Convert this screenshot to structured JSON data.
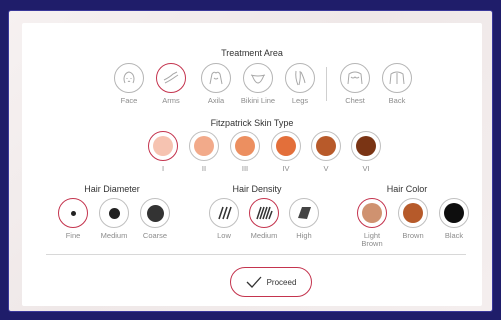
{
  "treatment_area": {
    "title": "Treatment Area",
    "items": [
      {
        "label": "Face",
        "icon": "face-icon",
        "selected": false
      },
      {
        "label": "Arms",
        "icon": "arm-icon",
        "selected": true
      },
      {
        "label": "Axila",
        "icon": "axilla-icon",
        "selected": false
      },
      {
        "label": "Bikini Line",
        "icon": "bikini-icon",
        "selected": false
      },
      {
        "label": "Legs",
        "icon": "legs-icon",
        "selected": false
      },
      {
        "label": "Chest",
        "icon": "chest-icon",
        "selected": false
      },
      {
        "label": "Back",
        "icon": "back-icon",
        "selected": false
      }
    ]
  },
  "skin_type": {
    "title": "Fitzpatrick Skin Type",
    "items": [
      {
        "label": "I",
        "color": "#f6c3b1",
        "selected": true
      },
      {
        "label": "II",
        "color": "#f2aa8a",
        "selected": false
      },
      {
        "label": "III",
        "color": "#ec8f60",
        "selected": false
      },
      {
        "label": "IV",
        "color": "#e36f3a",
        "selected": false
      },
      {
        "label": "V",
        "color": "#b85a2a",
        "selected": false
      },
      {
        "label": "VI",
        "color": "#7a3414",
        "selected": false
      }
    ]
  },
  "hair_diameter": {
    "title": "Hair Diameter",
    "items": [
      {
        "label": "Fine",
        "selected": true
      },
      {
        "label": "Medium",
        "selected": false
      },
      {
        "label": "Coarse",
        "selected": false
      }
    ]
  },
  "hair_density": {
    "title": "Hair Density",
    "items": [
      {
        "label": "Low",
        "selected": false
      },
      {
        "label": "Medium",
        "selected": true
      },
      {
        "label": "High",
        "selected": false
      }
    ]
  },
  "hair_color": {
    "title": "Hair Color",
    "items": [
      {
        "label": "Light Brown",
        "color": "#cf9270",
        "selected": true
      },
      {
        "label": "Brown",
        "color": "#b65a2a",
        "selected": false
      },
      {
        "label": "Black",
        "color": "#0e0e0e",
        "selected": false
      }
    ]
  },
  "proceed": {
    "label": "Proceed"
  },
  "colors": {
    "accent": "#c4344e",
    "background": "#1f1d6a"
  }
}
